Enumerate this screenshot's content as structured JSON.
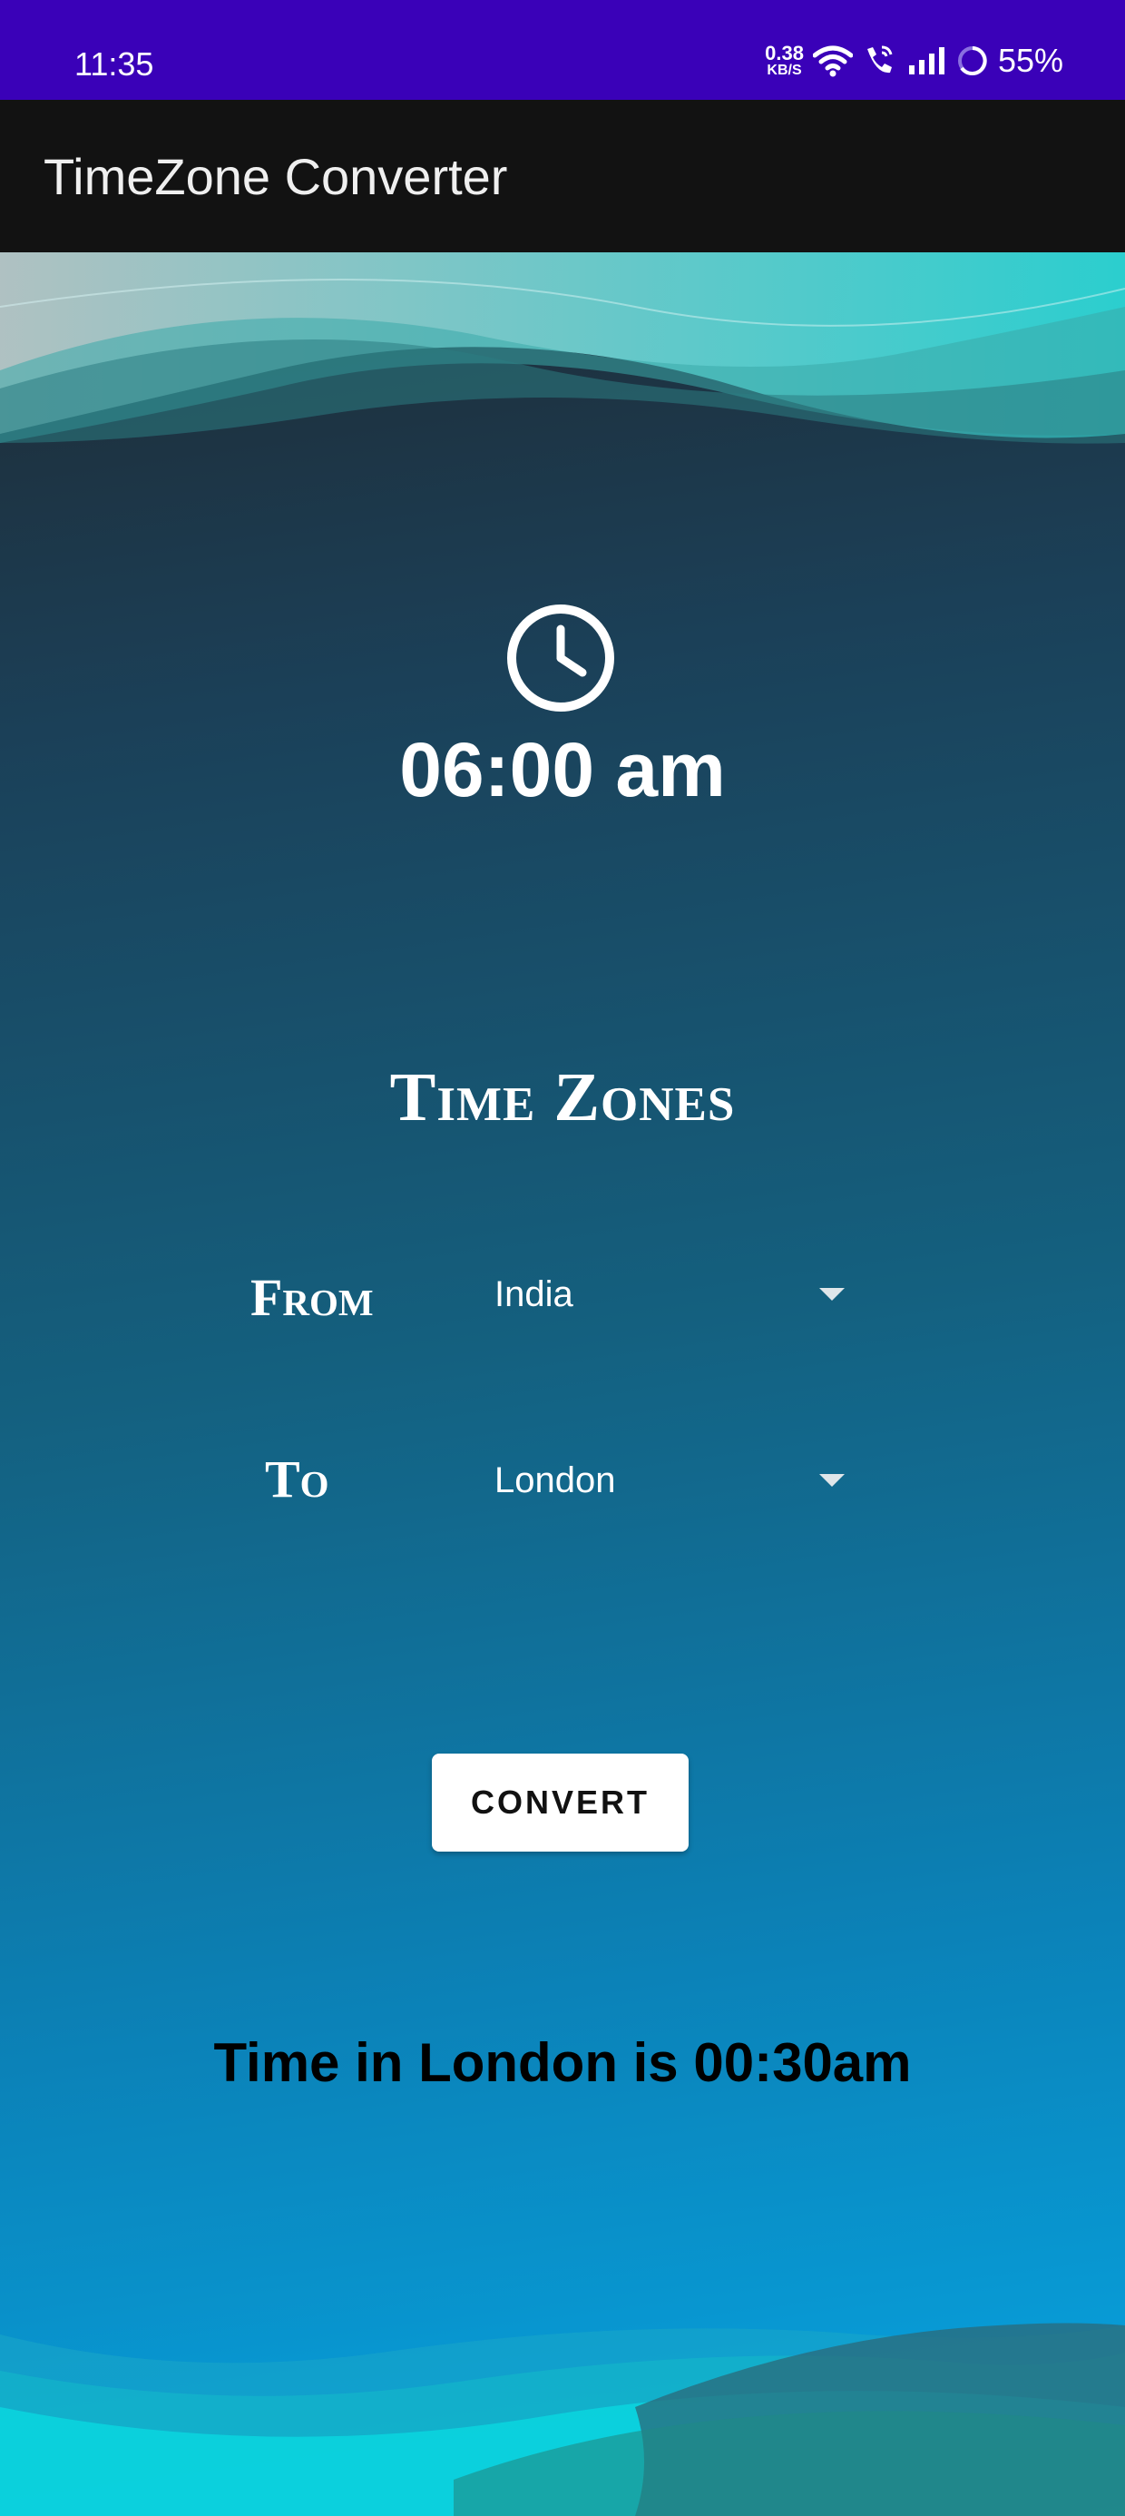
{
  "status_bar": {
    "time": "11:35",
    "net_speed_value": "0.38",
    "net_speed_unit": "KB/S",
    "battery": "55%",
    "wifi_icon": "wifi-icon",
    "call_icon": "wifi-calling-icon",
    "signal_icon": "cell-signal-icon",
    "battery_icon": "battery-ring-icon"
  },
  "app_bar": {
    "title": "TimeZone Converter"
  },
  "clock": {
    "icon": "clock-icon",
    "current_time": "06:00 am"
  },
  "time_zones": {
    "title": "Time Zones",
    "from_label": "From",
    "from_value": "India",
    "to_label": "To",
    "to_value": "London"
  },
  "convert_button": {
    "label": "CONVERT"
  },
  "result": {
    "text": "Time in London is 00:30am"
  },
  "colors": {
    "status_bar": "#3a01b8",
    "app_bar": "#121212",
    "teal_accent": "#2ccfd0",
    "button_bg": "#ffffff"
  }
}
